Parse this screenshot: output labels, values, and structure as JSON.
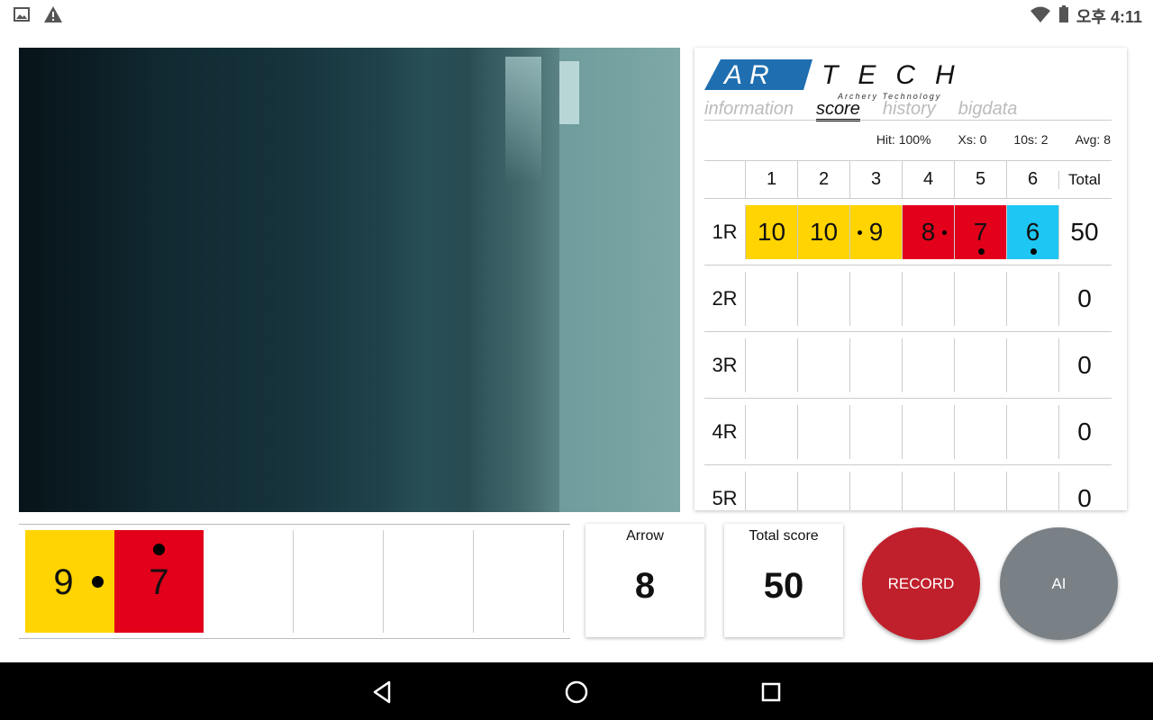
{
  "status_bar": {
    "time": "오후 4:11",
    "icons": [
      "image-icon",
      "warning-icon",
      "wifi-icon",
      "battery-icon"
    ]
  },
  "logo": {
    "brand_left": "AR",
    "brand_right": "TECH",
    "tagline": "Archery Technology"
  },
  "tabs": [
    {
      "label": "information",
      "active": false
    },
    {
      "label": "score",
      "active": true
    },
    {
      "label": "history",
      "active": false
    },
    {
      "label": "bigdata",
      "active": false
    }
  ],
  "stats": {
    "hit": "Hit: 100%",
    "xs": "Xs: 0",
    "tens": "10s: 2",
    "avg": "Avg: 8"
  },
  "score_table": {
    "columns": [
      "1",
      "2",
      "3",
      "4",
      "5",
      "6"
    ],
    "total_label": "Total",
    "rows": [
      {
        "label": "1R",
        "total": "50",
        "cells": [
          {
            "value": "10",
            "color": "#ffd400",
            "dot": "none"
          },
          {
            "value": "10",
            "color": "#ffd400",
            "dot": "none"
          },
          {
            "value": "9",
            "color": "#ffd400",
            "dot": "left"
          },
          {
            "value": "8",
            "color": "#e2001a",
            "dot": "right"
          },
          {
            "value": "7",
            "color": "#e2001a",
            "dot": "below"
          },
          {
            "value": "6",
            "color": "#1ec6f3",
            "dot": "below"
          }
        ]
      },
      {
        "label": "2R",
        "total": "0"
      },
      {
        "label": "3R",
        "total": "0"
      },
      {
        "label": "4R",
        "total": "0"
      },
      {
        "label": "5R",
        "total": "0"
      }
    ]
  },
  "current_end": [
    {
      "value": "9",
      "color": "#ffd400",
      "dot": "right"
    },
    {
      "value": "7",
      "color": "#e2001a",
      "dot": "above"
    }
  ],
  "arrow_card": {
    "label": "Arrow",
    "value": "8"
  },
  "total_card": {
    "label": "Total score",
    "value": "50"
  },
  "buttons": {
    "record": "RECORD",
    "ai": "AI"
  }
}
